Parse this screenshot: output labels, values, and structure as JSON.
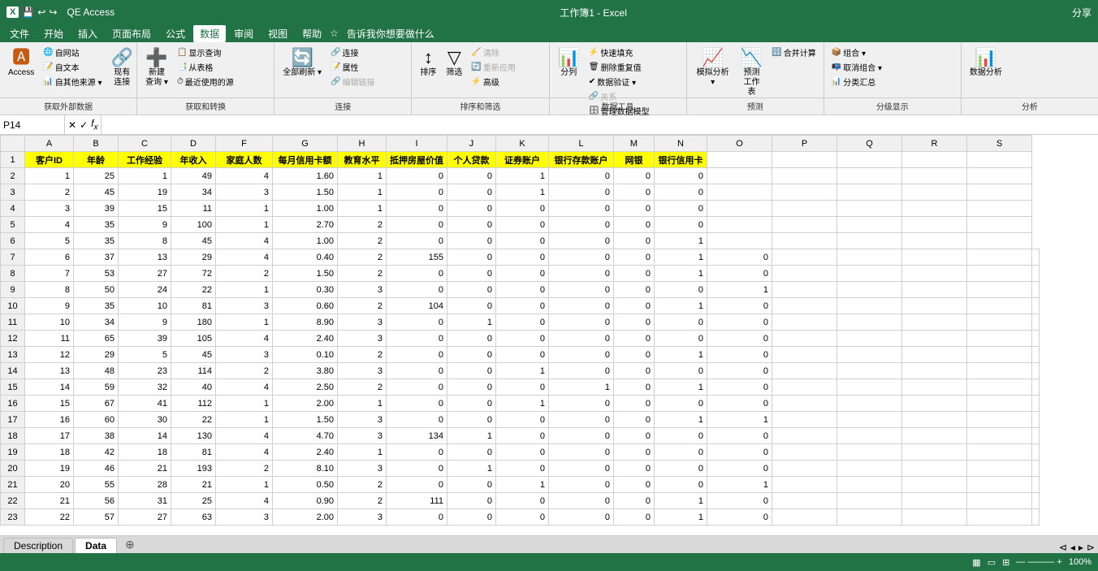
{
  "titleBar": {
    "left": "QE Access",
    "center": "工作簿1 - Excel",
    "shareBtn": "分享",
    "quickAccess": [
      "💾",
      "↩",
      "↪"
    ]
  },
  "menuBar": {
    "items": [
      "文件",
      "开始",
      "插入",
      "页面布局",
      "公式",
      "数据",
      "审阅",
      "视图",
      "帮助",
      "☆ 告诉我你想要做什么"
    ]
  },
  "ribbon": {
    "activeTab": "数据",
    "groups": [
      {
        "label": "获取外部数据",
        "buttons": [
          {
            "icon": "🅰",
            "label": "Access",
            "type": "big"
          },
          {
            "icon": "🌐",
            "label": "自网站",
            "type": "small"
          },
          {
            "icon": "📝",
            "label": "自文本",
            "type": "small"
          },
          {
            "icon": "📊",
            "label": "自其他来源",
            "type": "small"
          },
          {
            "icon": "🔗",
            "label": "现有连接",
            "type": "big"
          }
        ]
      },
      {
        "label": "获取和转换",
        "buttons": [
          {
            "icon": "➕",
            "label": "新建查询",
            "type": "big"
          },
          {
            "icon": "📋",
            "label": "显示查询",
            "type": "small"
          },
          {
            "icon": "📑",
            "label": "从表格",
            "type": "small"
          },
          {
            "icon": "⏱",
            "label": "最近使用的源",
            "type": "small"
          }
        ]
      },
      {
        "label": "连接",
        "buttons": [
          {
            "icon": "🔄",
            "label": "全部刷新",
            "type": "big"
          },
          {
            "icon": "🔗",
            "label": "连接",
            "type": "small"
          },
          {
            "icon": "📝",
            "label": "属性",
            "type": "small"
          },
          {
            "icon": "🔗",
            "label": "编辑链接",
            "type": "small",
            "disabled": true
          }
        ]
      },
      {
        "label": "排序和筛选",
        "buttons": [
          {
            "icon": "↑↓",
            "label": "排序",
            "type": "big"
          },
          {
            "icon": "▼",
            "label": "筛选",
            "type": "big"
          },
          {
            "icon": "🧹",
            "label": "清除",
            "type": "small"
          },
          {
            "icon": "🔄",
            "label": "重新应用",
            "type": "small"
          },
          {
            "icon": "⚡",
            "label": "高级",
            "type": "small"
          }
        ]
      },
      {
        "label": "数据工具",
        "buttons": [
          {
            "icon": "📊",
            "label": "分列",
            "type": "big"
          },
          {
            "icon": "⚡",
            "label": "快速填充",
            "type": "small"
          },
          {
            "icon": "🗑",
            "label": "删除重复值",
            "type": "small"
          },
          {
            "icon": "✔",
            "label": "数据验证",
            "type": "small"
          },
          {
            "icon": "🔗",
            "label": "关系",
            "type": "small",
            "disabled": true
          },
          {
            "icon": "🗄",
            "label": "管理数据模型",
            "type": "small"
          }
        ]
      },
      {
        "label": "预测",
        "buttons": [
          {
            "icon": "📈",
            "label": "模拟分析",
            "type": "big"
          },
          {
            "icon": "📉",
            "label": "预测工作表",
            "type": "big"
          },
          {
            "icon": "🔢",
            "label": "合并计算",
            "type": "small"
          }
        ]
      },
      {
        "label": "分级显示",
        "buttons": [
          {
            "icon": "📦",
            "label": "组合",
            "type": "small"
          },
          {
            "icon": "📭",
            "label": "取消组合",
            "type": "small"
          },
          {
            "icon": "📊",
            "label": "分类汇总",
            "type": "small"
          }
        ]
      },
      {
        "label": "分析",
        "buttons": [
          {
            "icon": "📊",
            "label": "数据分析",
            "type": "big"
          }
        ]
      }
    ]
  },
  "formulaBar": {
    "nameBox": "P14",
    "content": ""
  },
  "columns": {
    "letters": [
      "",
      "A",
      "B",
      "C",
      "D",
      "F",
      "G",
      "H",
      "I",
      "J",
      "K",
      "L",
      "M",
      "N",
      "O",
      "P",
      "Q",
      "R",
      "S"
    ],
    "widths": [
      30,
      60,
      55,
      65,
      55,
      70,
      80,
      60,
      70,
      60,
      65,
      80,
      45,
      65,
      80,
      80,
      80,
      80,
      80
    ]
  },
  "headers": [
    "客户ID",
    "年龄",
    "工作经验",
    "年收入",
    "家庭人数",
    "每月信用卡额",
    "教育水平",
    "抵押房屋价值",
    "个人贷款",
    "证券账户",
    "银行存款账户",
    "网银",
    "银行信用卡"
  ],
  "rows": [
    [
      1,
      25,
      1,
      49,
      4,
      1.6,
      1,
      0,
      0,
      1,
      0,
      0,
      0
    ],
    [
      2,
      45,
      19,
      34,
      3,
      1.5,
      1,
      0,
      0,
      1,
      0,
      0,
      0
    ],
    [
      3,
      39,
      15,
      11,
      1,
      1.0,
      1,
      0,
      0,
      0,
      0,
      0,
      0
    ],
    [
      4,
      35,
      9,
      100,
      1,
      2.7,
      2,
      0,
      0,
      0,
      0,
      0,
      0
    ],
    [
      5,
      35,
      8,
      45,
      4,
      1.0,
      2,
      0,
      0,
      0,
      0,
      0,
      1
    ],
    [
      6,
      37,
      13,
      29,
      4,
      0.4,
      2,
      155,
      0,
      0,
      0,
      0,
      1,
      0
    ],
    [
      7,
      53,
      27,
      72,
      2,
      1.5,
      2,
      0,
      0,
      0,
      0,
      0,
      1,
      0
    ],
    [
      8,
      50,
      24,
      22,
      1,
      0.3,
      3,
      0,
      0,
      0,
      0,
      0,
      0,
      1
    ],
    [
      9,
      35,
      10,
      81,
      3,
      0.6,
      2,
      104,
      0,
      0,
      0,
      0,
      1,
      0
    ],
    [
      10,
      34,
      9,
      180,
      1,
      8.9,
      3,
      0,
      1,
      0,
      0,
      0,
      0,
      0
    ],
    [
      11,
      65,
      39,
      105,
      4,
      2.4,
      3,
      0,
      0,
      0,
      0,
      0,
      0,
      0
    ],
    [
      12,
      29,
      5,
      45,
      3,
      0.1,
      2,
      0,
      0,
      0,
      0,
      0,
      1,
      0
    ],
    [
      13,
      48,
      23,
      114,
      2,
      3.8,
      3,
      0,
      0,
      1,
      0,
      0,
      0,
      0
    ],
    [
      14,
      59,
      32,
      40,
      4,
      2.5,
      2,
      0,
      0,
      0,
      1,
      0,
      1,
      0
    ],
    [
      15,
      67,
      41,
      112,
      1,
      2.0,
      1,
      0,
      0,
      1,
      0,
      0,
      0,
      0
    ],
    [
      16,
      60,
      30,
      22,
      1,
      1.5,
      3,
      0,
      0,
      0,
      0,
      0,
      1,
      1
    ],
    [
      17,
      38,
      14,
      130,
      4,
      4.7,
      3,
      134,
      1,
      0,
      0,
      0,
      0,
      0
    ],
    [
      18,
      42,
      18,
      81,
      4,
      2.4,
      1,
      0,
      0,
      0,
      0,
      0,
      0,
      0
    ],
    [
      19,
      46,
      21,
      193,
      2,
      8.1,
      3,
      0,
      1,
      0,
      0,
      0,
      0,
      0
    ],
    [
      20,
      55,
      28,
      21,
      1,
      0.5,
      2,
      0,
      0,
      1,
      0,
      0,
      0,
      1
    ],
    [
      21,
      56,
      31,
      25,
      4,
      0.9,
      2,
      111,
      0,
      0,
      0,
      0,
      1,
      0
    ],
    [
      22,
      57,
      27,
      63,
      3,
      2.0,
      3,
      0,
      0,
      0,
      0,
      0,
      1,
      0
    ]
  ],
  "sheets": [
    {
      "label": "Description",
      "active": false
    },
    {
      "label": "Data",
      "active": true
    }
  ],
  "statusBar": {
    "left": "",
    "right": {
      "viewIcons": [
        "▦",
        "▭",
        "⊞"
      ],
      "zoom": "100%"
    }
  }
}
